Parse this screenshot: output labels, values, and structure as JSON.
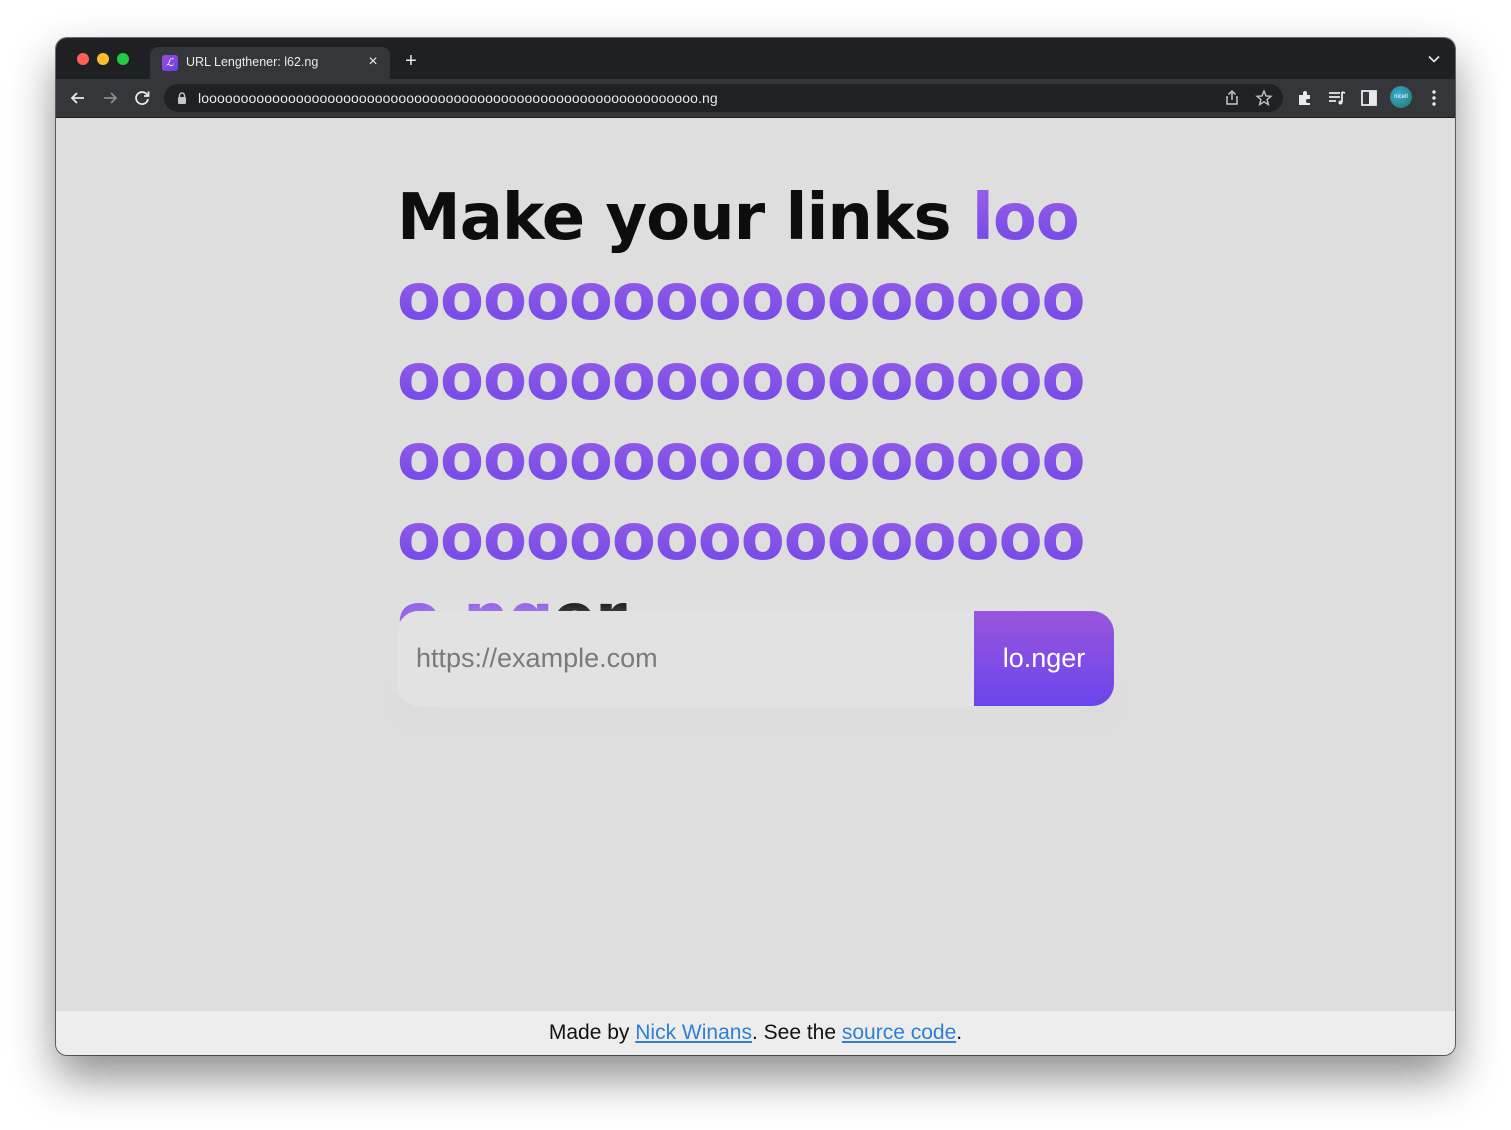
{
  "browser": {
    "tab": {
      "favicon_glyph": "ℒ",
      "title": "URL Lengthener: l62.ng",
      "close_glyph": "×"
    },
    "new_tab_glyph": "+",
    "address": "looooooooooooooooooooooooooooooooooooooooooooooooooooooooooooooo.ng",
    "avatar_text": "nicell"
  },
  "hero": {
    "lead": "Make your links ",
    "long_part": "looooooooooooooooooooooooooooooooooooooooooooooooooooooooooooooooooo.ng",
    "tail": "er"
  },
  "form": {
    "placeholder": "https://example.com",
    "button_label": "lo.nger"
  },
  "footer": {
    "prefix": "Made by ",
    "author_link": "Nick Winans",
    "middle": ". See the ",
    "source_link": "source code",
    "suffix": "."
  },
  "colors": {
    "accent_top": "#a060e6",
    "accent_bottom": "#6b46e8",
    "link": "#2f7fd3",
    "page_bg": "#dedede"
  },
  "icons": [
    "back-arrow-icon",
    "forward-arrow-icon",
    "reload-icon",
    "lock-icon",
    "share-icon",
    "star-icon",
    "extensions-icon",
    "media-queue-icon",
    "side-panel-icon",
    "kebab-menu-icon",
    "chevron-down-icon"
  ]
}
